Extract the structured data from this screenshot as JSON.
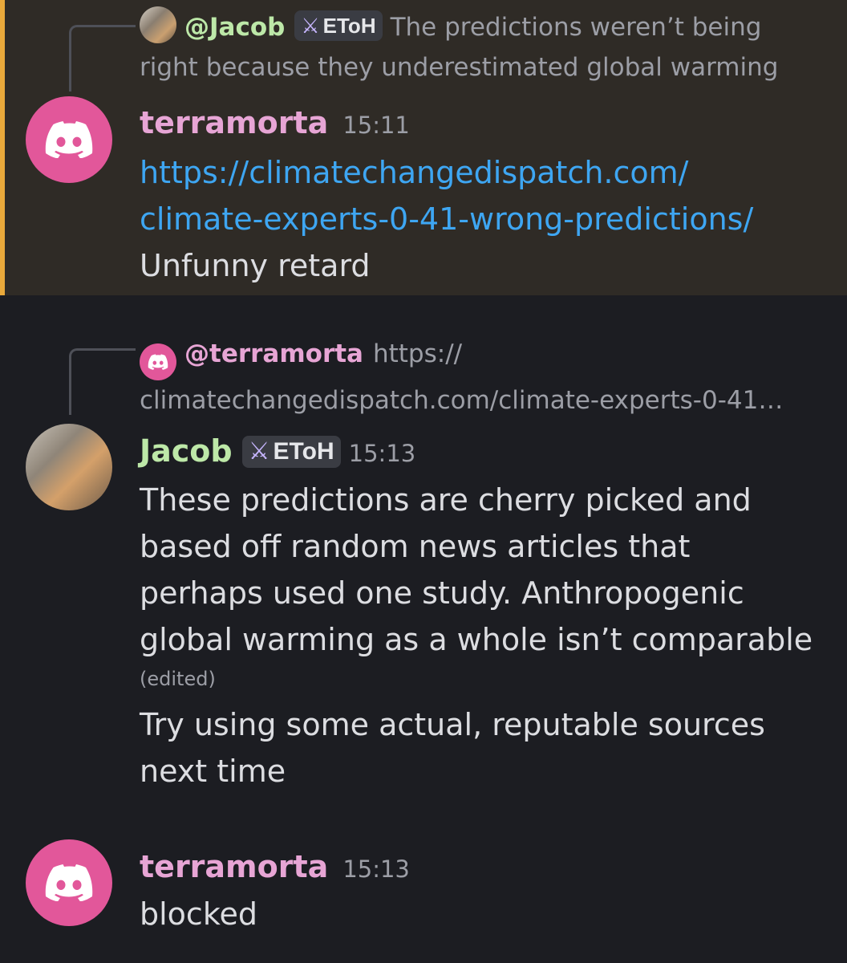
{
  "colors": {
    "accent_bar": "#e9a93b",
    "terramorta_name": "#e7a5d5",
    "jacob_name": "#bde8a8",
    "link": "#3ea6f2",
    "discord_avatar": "#e2579a"
  },
  "messages": [
    {
      "highlighted": true,
      "reply": {
        "username": "@Jacob",
        "badge": "EToH",
        "badge_icon": "sword-icon",
        "text": "The predictions weren’t being right because they underestimated global warming"
      },
      "username": "terramorta",
      "timestamp": "15:11",
      "link": "https://climatechangedispatch.com/climate-experts-0-41-wrong-predictions/",
      "link_lines": [
        "https://climatechangedispatch.com/",
        "climate-experts-0-41-wrong-predictions/"
      ],
      "text": "Unfunny retard"
    },
    {
      "reply": {
        "username": "@terramorta",
        "text_line1": "https://",
        "text_line2": "climatechangedispatch.com/climate-experts-0-41…"
      },
      "username": "Jacob",
      "badge": "EToH",
      "badge_icon": "sword-icon",
      "timestamp": "15:13",
      "text_lines": [
        "These predictions are cherry picked and",
        "based off random news articles that",
        "perhaps used one study. Anthropogenic",
        "global warming as a whole isn’t comparable"
      ],
      "edited_label": "(edited)",
      "text2_lines": [
        "Try using some actual, reputable sources",
        "next time"
      ]
    },
    {
      "username": "terramorta",
      "timestamp": "15:13",
      "text": "blocked"
    }
  ]
}
